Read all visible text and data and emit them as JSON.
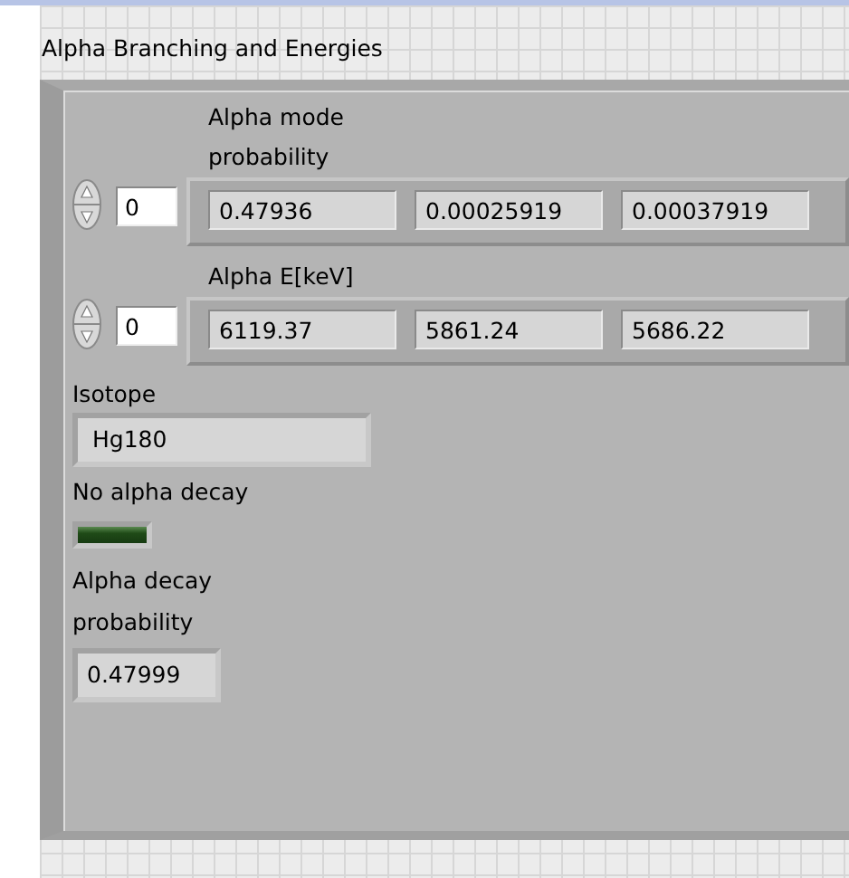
{
  "title": "Alpha Branching and Energies",
  "arrays": [
    {
      "label": "Alpha mode probability",
      "index": "0",
      "values": [
        "0.47936",
        "0.00025919",
        "0.00037919"
      ]
    },
    {
      "label": "Alpha E[keV]",
      "index": "0",
      "values": [
        "6119.37",
        "5861.24",
        "5686.22"
      ]
    }
  ],
  "isotope": {
    "label": "Isotope",
    "value": "Hg180"
  },
  "indicator": {
    "label": "No alpha decay",
    "on": false
  },
  "decay_probability": {
    "label": "Alpha decay probability",
    "value": "0.47999"
  }
}
